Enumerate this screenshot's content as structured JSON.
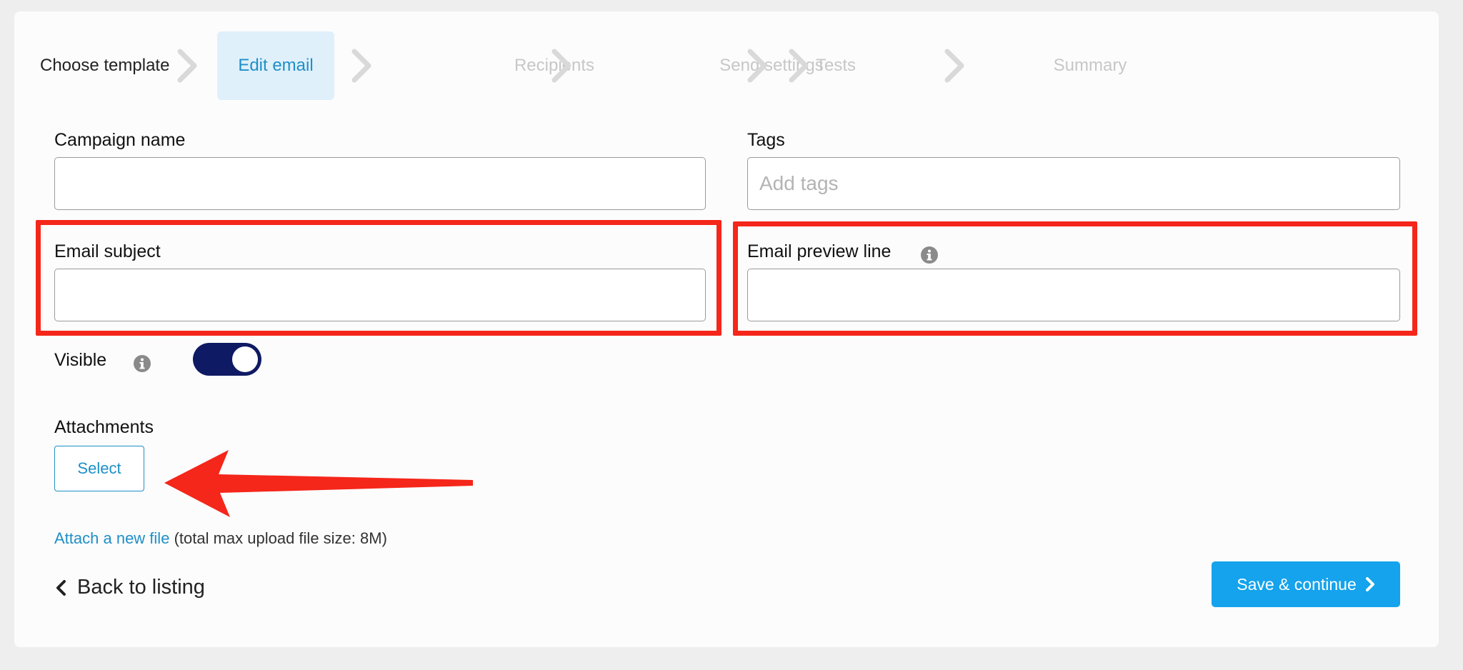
{
  "steps": [
    {
      "label": "Choose template",
      "state": "done"
    },
    {
      "label": "Edit email",
      "state": "active"
    },
    {
      "label": "Recipients",
      "state": "pending"
    },
    {
      "label": "Send settings",
      "state": "pending"
    },
    {
      "label": "Tests",
      "state": "pending"
    },
    {
      "label": "Summary",
      "state": "pending"
    }
  ],
  "form": {
    "campaign_name": {
      "label": "Campaign name",
      "value": ""
    },
    "tags": {
      "label": "Tags",
      "placeholder": "Add tags",
      "value": ""
    },
    "email_subject": {
      "label": "Email subject",
      "value": ""
    },
    "email_preview_line": {
      "label": "Email preview line",
      "value": ""
    },
    "visible": {
      "label": "Visible",
      "enabled": true
    },
    "attachments": {
      "label": "Attachments",
      "select_label": "Select",
      "attach_link": "Attach a new file",
      "attach_note": "(total max upload file size: 8M)"
    }
  },
  "footer": {
    "back_label": "Back to listing",
    "save_label": "Save & continue"
  },
  "icons": {
    "step_separator": "chevron-right-icon",
    "info": "info-icon",
    "back": "chevron-left-icon",
    "save": "chevron-right-icon"
  },
  "colors": {
    "accent": "#1f8fc7",
    "active_step_bg": "#dff0fb",
    "primary_button": "#14a3ec",
    "toggle_on": "#0f1a64",
    "annotation_red": "#f5261a"
  }
}
